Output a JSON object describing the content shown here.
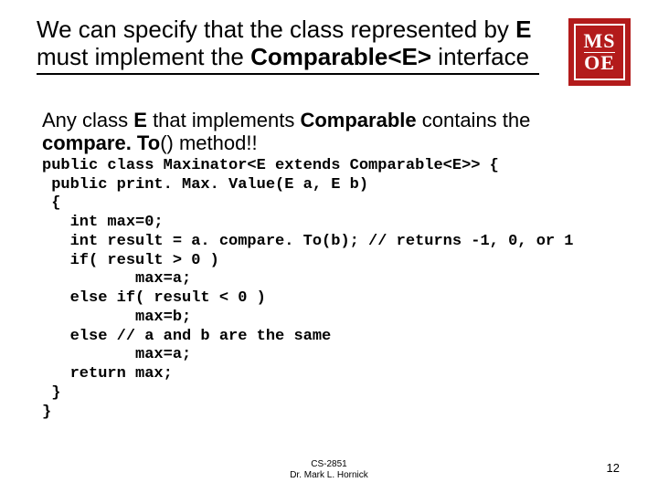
{
  "title": {
    "t1": "We can specify that the class represented by ",
    "t2": "E",
    "t3": " must implement the ",
    "t4": "Comparable<E>",
    "t5": " interface"
  },
  "logo": {
    "top": "MS",
    "bottom": "OE"
  },
  "subtitle": {
    "s1": "Any class ",
    "s2": "E",
    "s3": " that implements ",
    "s4": "Comparable",
    "s5": " contains the ",
    "s6": "compare. To",
    "s7": "() method!!"
  },
  "code": "public class Maxinator<E extends Comparable<E>> {\n public print. Max. Value(E a, E b)\n {\n   int max=0;\n   int result = a. compare. To(b); // returns -1, 0, or 1\n   if( result > 0 )\n          max=a;\n   else if( result < 0 )\n          max=b;\n   else // a and b are the same\n          max=a;\n   return max;\n }\n}",
  "footer": {
    "course": "CS-2851",
    "author": "Dr. Mark L. Hornick"
  },
  "page": "12"
}
